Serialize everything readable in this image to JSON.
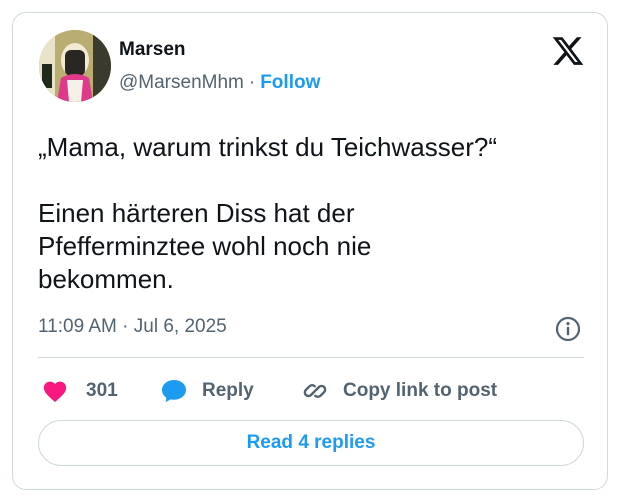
{
  "author": {
    "name": "Marsen",
    "handle": "@MarsenMhm",
    "separator": "·",
    "follow_label": "Follow"
  },
  "tweet": {
    "text": "„Mama, warum trinkst du Teichwasser?“\n\nEinen härteren Diss hat der\nPfefferminztee wohl noch nie\nbekommen.",
    "timestamp": "11:09 AM · Jul 6, 2025"
  },
  "actions": {
    "like_count": "301",
    "reply_label": "Reply",
    "copy_label": "Copy link to post"
  },
  "replies_button": {
    "label": "Read 4 replies"
  },
  "icons": {
    "platform": "x-logo-icon",
    "info": "info-icon",
    "like": "heart-icon",
    "reply": "speech-bubble-icon",
    "copy": "link-icon"
  },
  "colors": {
    "accent": "#1d9bf0",
    "like": "#f91880",
    "text": "#0f1419",
    "secondary": "#536471",
    "border": "#cfd9de"
  }
}
